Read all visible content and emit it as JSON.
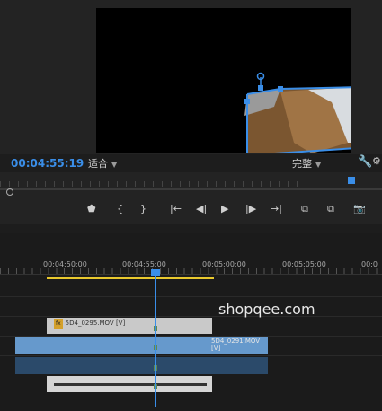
{
  "monitor": {
    "timecode": "00:04:55:19",
    "fit_label": "适合",
    "quality_label": "完整"
  },
  "transport": {
    "marker": "⬟",
    "in_point": "{",
    "out_point": "}",
    "go_to_in": "|←",
    "step_back": "◀|",
    "play": "▶",
    "step_forward": "|▶",
    "go_to_out": "→|"
  },
  "timeline": {
    "timecodes": [
      "00:04:50:00",
      "00:04:55:00",
      "00:05:00:00",
      "00:05:05:00",
      "00:0"
    ],
    "clip_v2": "5D4_0295.MOV [V]",
    "clip_v1": "5D4_0291.MOV [V]"
  },
  "watermark": "shopqee.com",
  "colors": {
    "accent": "#3a8ee8",
    "work_area": "#e8c82e",
    "clip_video": "#6699cc"
  }
}
